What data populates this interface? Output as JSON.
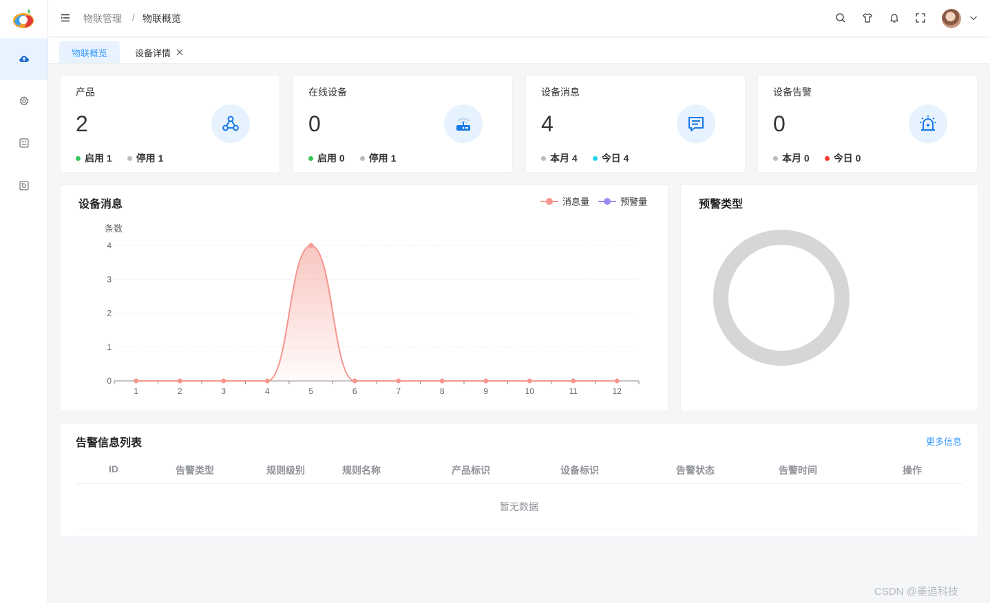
{
  "header": {
    "breadcrumb": [
      "物联管理",
      "物联概览"
    ],
    "breadcrumb_separator": "/",
    "icons": [
      "search-icon",
      "shirt-icon",
      "bell-icon",
      "fullscreen-icon",
      "avatar",
      "chevron-down-icon"
    ]
  },
  "sidebar": {
    "items": [
      {
        "icon": "cloud-upload-icon",
        "active": true
      },
      {
        "icon": "gear-icon",
        "active": false
      },
      {
        "icon": "panel-icon",
        "active": false
      },
      {
        "icon": "device-icon",
        "active": false
      }
    ]
  },
  "tabs": [
    {
      "label": "物联概览",
      "active": true
    },
    {
      "label": "设备详情",
      "active": false,
      "closable": true
    }
  ],
  "stats": [
    {
      "title": "产品",
      "value": "2",
      "icon": "share-nodes-icon",
      "footer": [
        {
          "label": "启用",
          "value": "1",
          "color": "#34c759"
        },
        {
          "label": "停用",
          "value": "1",
          "color": "#bbbbbb"
        }
      ]
    },
    {
      "title": "在线设备",
      "value": "0",
      "icon": "router-icon",
      "footer": [
        {
          "label": "启用",
          "value": "0",
          "color": "#34c759"
        },
        {
          "label": "停用",
          "value": "1",
          "color": "#bbbbbb"
        }
      ]
    },
    {
      "title": "设备消息",
      "value": "4",
      "icon": "message-icon",
      "footer": [
        {
          "label": "本月",
          "value": "4",
          "color": "#bbbbbb"
        },
        {
          "label": "今日",
          "value": "4",
          "color": "#22d3ee"
        }
      ]
    },
    {
      "title": "设备告警",
      "value": "0",
      "icon": "alarm-icon",
      "footer": [
        {
          "label": "本月",
          "value": "0",
          "color": "#bbbbbb"
        },
        {
          "label": "今日",
          "value": "0",
          "color": "#ff3b30"
        }
      ]
    }
  ],
  "message_panel": {
    "title": "设备消息",
    "legend": [
      {
        "name": "消息量",
        "color": "#f4978e"
      },
      {
        "name": "预警量",
        "color": "#9b8cf5"
      }
    ]
  },
  "warning_panel": {
    "title": "预警类型"
  },
  "chart_data": {
    "type": "line",
    "ylabel": "条数",
    "x": [
      1,
      2,
      3,
      4,
      5,
      6,
      7,
      8,
      9,
      10,
      11,
      12
    ],
    "ylim": [
      0,
      4
    ],
    "yticks": [
      0,
      1,
      2,
      3,
      4
    ],
    "series": [
      {
        "name": "消息量",
        "color": "#f4978e",
        "values": [
          0,
          0,
          0,
          0,
          4,
          0,
          0,
          0,
          0,
          0,
          0,
          0
        ],
        "smooth": true,
        "area": true
      },
      {
        "name": "预警量",
        "color": "#9b8cf5",
        "values": []
      }
    ]
  },
  "alarm_table": {
    "title": "告警信息列表",
    "more_label": "更多信息",
    "columns": [
      "ID",
      "告警类型",
      "规则级别",
      "规则名称",
      "产品标识",
      "设备标识",
      "告警状态",
      "告警时间",
      "操作"
    ],
    "rows": [],
    "empty_text": "暂无数据"
  },
  "watermark": "CSDN @墨追科技"
}
